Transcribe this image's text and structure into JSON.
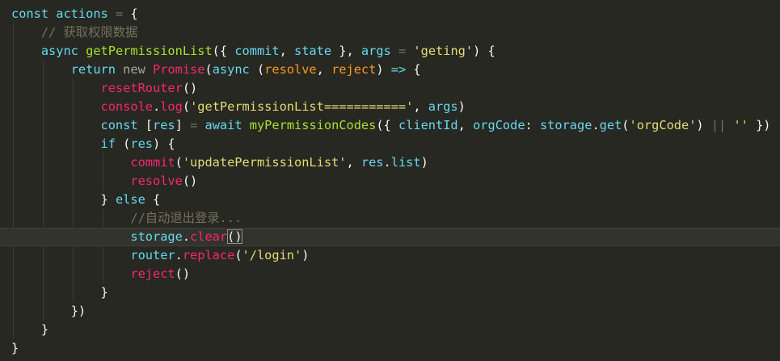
{
  "editor": {
    "lines": [
      {
        "tokens": [
          {
            "t": "const ",
            "c": "kw"
          },
          {
            "t": "actions",
            "c": "var"
          },
          {
            "t": " ",
            "c": "plain"
          },
          {
            "t": "=",
            "c": "op"
          },
          {
            "t": " {",
            "c": "plain"
          }
        ]
      },
      {
        "tokens": [
          {
            "t": "    ",
            "c": "plain"
          },
          {
            "t": "// 获取权限数据",
            "c": "cmt"
          }
        ]
      },
      {
        "tokens": [
          {
            "t": "    ",
            "c": "plain"
          },
          {
            "t": "async ",
            "c": "kw"
          },
          {
            "t": "getPermissionList",
            "c": "fn"
          },
          {
            "t": "({ ",
            "c": "plain"
          },
          {
            "t": "commit",
            "c": "var"
          },
          {
            "t": ", ",
            "c": "plain"
          },
          {
            "t": "state",
            "c": "var"
          },
          {
            "t": " }, ",
            "c": "plain"
          },
          {
            "t": "args",
            "c": "var"
          },
          {
            "t": " ",
            "c": "plain"
          },
          {
            "t": "=",
            "c": "op"
          },
          {
            "t": " ",
            "c": "plain"
          },
          {
            "t": "'geting'",
            "c": "str"
          },
          {
            "t": ") {",
            "c": "plain"
          }
        ]
      },
      {
        "tokens": [
          {
            "t": "        ",
            "c": "plain"
          },
          {
            "t": "return ",
            "c": "kw"
          },
          {
            "t": "new ",
            "c": "mut"
          },
          {
            "t": "Promise",
            "c": "red"
          },
          {
            "t": "(",
            "c": "plain"
          },
          {
            "t": "async ",
            "c": "kw"
          },
          {
            "t": "(",
            "c": "plain"
          },
          {
            "t": "resolve",
            "c": "prm"
          },
          {
            "t": ", ",
            "c": "plain"
          },
          {
            "t": "reject",
            "c": "prm"
          },
          {
            "t": ") ",
            "c": "plain"
          },
          {
            "t": "=>",
            "c": "kw"
          },
          {
            "t": " {",
            "c": "plain"
          }
        ]
      },
      {
        "tokens": [
          {
            "t": "            ",
            "c": "plain"
          },
          {
            "t": "resetRouter",
            "c": "red"
          },
          {
            "t": "()",
            "c": "plain"
          }
        ]
      },
      {
        "tokens": [
          {
            "t": "            ",
            "c": "plain"
          },
          {
            "t": "console",
            "c": "red"
          },
          {
            "t": ".",
            "c": "plain"
          },
          {
            "t": "log",
            "c": "red"
          },
          {
            "t": "(",
            "c": "plain"
          },
          {
            "t": "'getPermissionList==========='",
            "c": "str"
          },
          {
            "t": ", ",
            "c": "plain"
          },
          {
            "t": "args",
            "c": "var"
          },
          {
            "t": ")",
            "c": "plain"
          }
        ]
      },
      {
        "tokens": [
          {
            "t": "            ",
            "c": "plain"
          },
          {
            "t": "const ",
            "c": "kw"
          },
          {
            "t": "[",
            "c": "plain"
          },
          {
            "t": "res",
            "c": "var"
          },
          {
            "t": "] ",
            "c": "plain"
          },
          {
            "t": "=",
            "c": "op"
          },
          {
            "t": " ",
            "c": "plain"
          },
          {
            "t": "await ",
            "c": "kw"
          },
          {
            "t": "myPermissionCodes",
            "c": "fn"
          },
          {
            "t": "({ ",
            "c": "plain"
          },
          {
            "t": "clientId",
            "c": "var"
          },
          {
            "t": ", ",
            "c": "plain"
          },
          {
            "t": "orgCode",
            "c": "var"
          },
          {
            "t": ": ",
            "c": "plain"
          },
          {
            "t": "storage",
            "c": "var"
          },
          {
            "t": ".",
            "c": "plain"
          },
          {
            "t": "get",
            "c": "var"
          },
          {
            "t": "(",
            "c": "plain"
          },
          {
            "t": "'orgCode'",
            "c": "str"
          },
          {
            "t": ") ",
            "c": "plain"
          },
          {
            "t": "||",
            "c": "op"
          },
          {
            "t": " ",
            "c": "plain"
          },
          {
            "t": "''",
            "c": "str"
          },
          {
            "t": " })",
            "c": "plain"
          }
        ]
      },
      {
        "tokens": [
          {
            "t": "            ",
            "c": "plain"
          },
          {
            "t": "if ",
            "c": "kw"
          },
          {
            "t": "(",
            "c": "plain"
          },
          {
            "t": "res",
            "c": "var"
          },
          {
            "t": ") {",
            "c": "plain"
          }
        ]
      },
      {
        "tokens": [
          {
            "t": "                ",
            "c": "plain"
          },
          {
            "t": "commit",
            "c": "red"
          },
          {
            "t": "(",
            "c": "plain"
          },
          {
            "t": "'updatePermissionList'",
            "c": "str"
          },
          {
            "t": ", ",
            "c": "plain"
          },
          {
            "t": "res",
            "c": "var"
          },
          {
            "t": ".",
            "c": "plain"
          },
          {
            "t": "list",
            "c": "var"
          },
          {
            "t": ")",
            "c": "plain"
          }
        ]
      },
      {
        "tokens": [
          {
            "t": "                ",
            "c": "plain"
          },
          {
            "t": "resolve",
            "c": "red"
          },
          {
            "t": "()",
            "c": "plain"
          }
        ]
      },
      {
        "tokens": [
          {
            "t": "            ",
            "c": "plain"
          },
          {
            "t": "} ",
            "c": "plain"
          },
          {
            "t": "else ",
            "c": "kw"
          },
          {
            "t": "{",
            "c": "plain"
          }
        ]
      },
      {
        "tokens": [
          {
            "t": "                ",
            "c": "plain"
          },
          {
            "t": "//自动退出登录...",
            "c": "cmt"
          }
        ]
      },
      {
        "tokens": [
          {
            "t": "                ",
            "c": "plain"
          },
          {
            "t": "storage",
            "c": "var"
          },
          {
            "t": ".",
            "c": "plain"
          },
          {
            "t": "clear",
            "c": "red"
          },
          {
            "t": "()",
            "c": "plain",
            "box": true
          }
        ],
        "current": true
      },
      {
        "tokens": [
          {
            "t": "                ",
            "c": "plain"
          },
          {
            "t": "router",
            "c": "var"
          },
          {
            "t": ".",
            "c": "plain"
          },
          {
            "t": "replace",
            "c": "red"
          },
          {
            "t": "(",
            "c": "plain"
          },
          {
            "t": "'/login'",
            "c": "str"
          },
          {
            "t": ")",
            "c": "plain"
          }
        ]
      },
      {
        "tokens": [
          {
            "t": "                ",
            "c": "plain"
          },
          {
            "t": "reject",
            "c": "red"
          },
          {
            "t": "()",
            "c": "plain"
          }
        ]
      },
      {
        "tokens": [
          {
            "t": "            ",
            "c": "plain"
          },
          {
            "t": "}",
            "c": "plain"
          }
        ]
      },
      {
        "tokens": [
          {
            "t": "        ",
            "c": "plain"
          },
          {
            "t": "})",
            "c": "plain"
          }
        ]
      },
      {
        "tokens": [
          {
            "t": "    ",
            "c": "plain"
          },
          {
            "t": "}",
            "c": "plain"
          }
        ]
      },
      {
        "tokens": [
          {
            "t": "}",
            "c": "plain"
          }
        ]
      }
    ]
  },
  "theme": {
    "background": "#272822",
    "current_line": "#32332c",
    "comment": "#75715e",
    "keyword": "#66d9ef",
    "function": "#a6e22e",
    "call": "#f92672",
    "string": "#e6db74",
    "parameter": "#fd971f"
  }
}
